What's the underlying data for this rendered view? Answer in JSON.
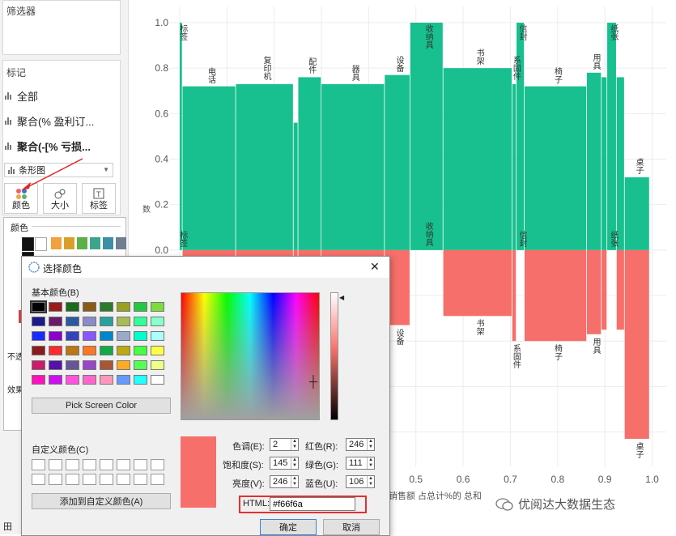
{
  "left_panel": {
    "filters_title": "筛选器",
    "marks_title": "标记",
    "mark_items": [
      {
        "label": "全部",
        "bold": false
      },
      {
        "label": "聚合(% 盈利订...",
        "bold": false
      },
      {
        "label": "聚合(-[% 亏损...",
        "bold": true
      }
    ],
    "mark_type": "条形图",
    "buttons": [
      {
        "label": "颜色",
        "icon": "color-dots-icon"
      },
      {
        "label": "大小",
        "icon": "size-icon"
      },
      {
        "label": "标签",
        "icon": "label-icon"
      }
    ],
    "palette_title": "颜色",
    "palette_fragments": [
      "不透",
      "效果"
    ]
  },
  "chart_data": {
    "type": "bar",
    "subtype": "marimekko",
    "x_ticks": [
      "0.5",
      "0.6",
      "0.7",
      "0.8",
      "0.9",
      "1.0"
    ],
    "y_ticks": [
      "1.0",
      "0.8",
      "0.6",
      "0.4",
      "0.2",
      "0.0"
    ],
    "xlim": [
      0.0,
      1.03
    ],
    "ylim": [
      -0.88,
      1.0
    ],
    "xlabel": "销售额 占总计%的 总和",
    "ylabel": "数",
    "colors": {
      "positive": "#17c08e",
      "negative": "#f66f6a"
    },
    "segments": [
      {
        "x0": 0.0,
        "x1": 0.006,
        "pos": 1.0,
        "neg": 0.0,
        "label": "标签"
      },
      {
        "x0": 0.006,
        "x1": 0.119,
        "pos": 0.72,
        "neg": 0.28,
        "label": "电话"
      },
      {
        "x0": 0.119,
        "x1": 0.241,
        "pos": 0.73,
        "neg": 0.27,
        "label": "复印机"
      },
      {
        "x0": 0.241,
        "x1": 0.251,
        "pos": 0.56,
        "neg": 0.44,
        "label": ""
      },
      {
        "x0": 0.251,
        "x1": 0.3,
        "pos": 0.76,
        "neg": 0.24,
        "label": "配件"
      },
      {
        "x0": 0.3,
        "x1": 0.434,
        "pos": 0.73,
        "neg": 0.27,
        "label": "器具"
      },
      {
        "x0": 0.434,
        "x1": 0.488,
        "pos": 0.77,
        "neg": 0.33,
        "label": "设备"
      },
      {
        "x0": 0.488,
        "x1": 0.558,
        "pos": 1.0,
        "neg": 0.0,
        "label": "收纳具"
      },
      {
        "x0": 0.558,
        "x1": 0.704,
        "pos": 0.8,
        "neg": 0.29,
        "label": "书架"
      },
      {
        "x0": 0.704,
        "x1": 0.713,
        "pos": 0.73,
        "neg": 0.4,
        "label": "系固件"
      },
      {
        "x0": 0.713,
        "x1": 0.73,
        "pos": 1.0,
        "neg": 0.0,
        "label": "信封"
      },
      {
        "x0": 0.73,
        "x1": 0.862,
        "pos": 0.72,
        "neg": 0.4,
        "label": "椅子"
      },
      {
        "x0": 0.862,
        "x1": 0.893,
        "pos": 0.78,
        "neg": 0.37,
        "label": "用具"
      },
      {
        "x0": 0.893,
        "x1": 0.905,
        "pos": 0.76,
        "neg": 0.35,
        "label": ""
      },
      {
        "x0": 0.905,
        "x1": 0.925,
        "pos": 1.0,
        "neg": 0.0,
        "label": "纸张"
      },
      {
        "x0": 0.925,
        "x1": 0.942,
        "pos": 0.76,
        "neg": 0.35,
        "label": ""
      },
      {
        "x0": 0.942,
        "x1": 0.995,
        "pos": 0.32,
        "neg": 0.83,
        "label": "桌子"
      }
    ]
  },
  "dialog": {
    "title": "选择颜色",
    "close_glyph": "✕",
    "basic_colors_label": "基本颜色(B)",
    "basic_colors": [
      "#000000",
      "#9b1b1b",
      "#1b6b1b",
      "#8b5a14",
      "#2b7a2b",
      "#9aa01e",
      "#22c842",
      "#7ddc3c",
      "#1b1b8b",
      "#6b1b6b",
      "#2b5aa0",
      "#8b8bc8",
      "#2aa0a0",
      "#aabb55",
      "#33ff99",
      "#88ffcc",
      "#1b2bff",
      "#8b00cc",
      "#3344bb",
      "#8855ff",
      "#0088cc",
      "#99aacc",
      "#00ffcc",
      "#aaffff",
      "#8b1b1b",
      "#ff2b2b",
      "#bb7711",
      "#ff7722",
      "#11aa44",
      "#bbaa11",
      "#44ff44",
      "#ffff44",
      "#cc1b6b",
      "#5511aa",
      "#665599",
      "#9944cc",
      "#aa5533",
      "#ffaa22",
      "#55ff55",
      "#eeff88",
      "#ff11bb",
      "#cc11ee",
      "#ff55dd",
      "#ff66cc",
      "#ff99bb",
      "#6699ff",
      "#22ffff",
      "#ffffff"
    ],
    "pick_screen_color": "Pick Screen Color",
    "custom_colors_label": "自定义颜色(C)",
    "add_custom": "添加到自定义颜色(A)",
    "current_color": "#f66f6a",
    "fields": {
      "hue_label": "色调(E):",
      "hue": "2",
      "sat_label": "饱和度(S):",
      "sat": "145",
      "val_label": "亮度(V):",
      "val": "246",
      "red_label": "红色(R):",
      "red": "246",
      "green_label": "绿色(G):",
      "green": "111",
      "blue_label": "蓝色(U):",
      "blue": "106"
    },
    "html_label": "HTML:",
    "html_value": "#f66f6a",
    "ok": "确定",
    "cancel": "取消"
  },
  "watermark": "优阅达大数据生态",
  "bottom_fragment": "田"
}
